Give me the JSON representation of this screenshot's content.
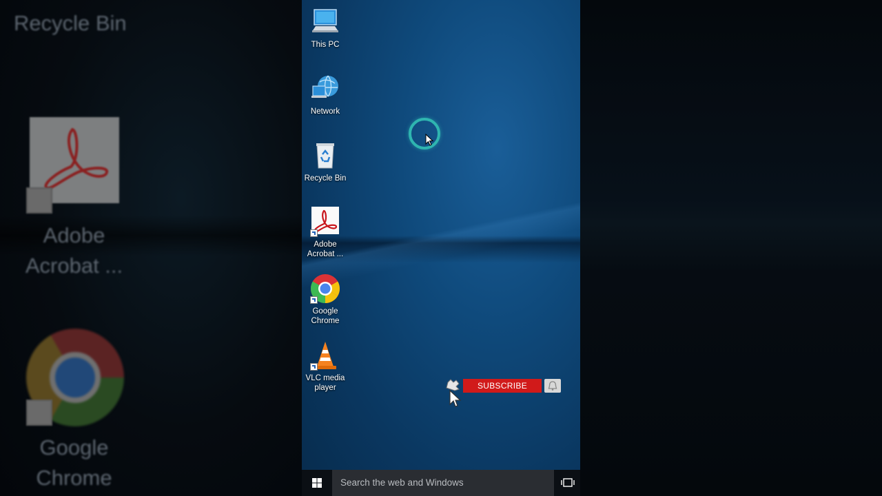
{
  "left_panel": {
    "recycle_label": "Recycle Bin",
    "acrobat_label_1": "Adobe",
    "acrobat_label_2": "Acrobat ...",
    "chrome_label_1": "Google",
    "chrome_label_2": "Chrome"
  },
  "desktop": {
    "icons": [
      {
        "name": "This PC",
        "line1": "This PC",
        "line2": ""
      },
      {
        "name": "Network",
        "line1": "Network",
        "line2": ""
      },
      {
        "name": "Recycle Bin",
        "line1": "Recycle Bin",
        "line2": ""
      },
      {
        "name": "Adobe Acrobat",
        "line1": "Adobe",
        "line2": "Acrobat ..."
      },
      {
        "name": "Google Chrome",
        "line1": "Google",
        "line2": "Chrome"
      },
      {
        "name": "VLC media player",
        "line1": "VLC media",
        "line2": "player"
      }
    ]
  },
  "overlay": {
    "subscribe_label": "SUBSCRIBE",
    "bell_icon": "bell-icon",
    "hand_icon": "hand-pointer-icon"
  },
  "taskbar": {
    "search_placeholder": "Search the web and Windows",
    "start_icon": "windows-logo-icon",
    "taskview_icon": "task-view-icon"
  },
  "colors": {
    "accent_click_ring": "#2fb5b0",
    "subscribe_red": "#d11a1a",
    "taskbar_bg": "#0b0f14",
    "search_bg": "#2a2d32"
  }
}
